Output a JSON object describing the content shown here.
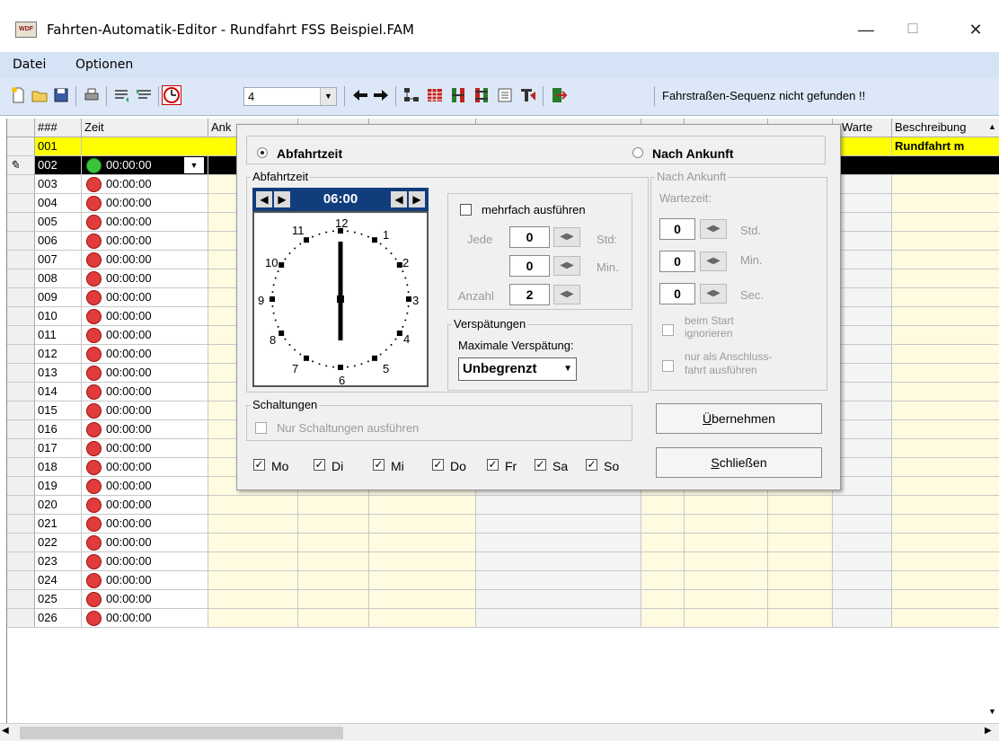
{
  "window": {
    "title": "Fahrten-Automatik-Editor - Rundfahrt FSS Beispiel.FAM",
    "app_icon_text": "WDF",
    "minimize": "—",
    "maximize": "☐",
    "close": "✕"
  },
  "menu": [
    {
      "label": "Datei"
    },
    {
      "label": "Optionen"
    }
  ],
  "toolbar": {
    "combo_value": "4",
    "status": "Fahrstraßen-Sequenz nicht gefunden !!"
  },
  "grid": {
    "columns": {
      "num": "###",
      "zeit": "Zeit",
      "ank": "Ank",
      "warte": "Warte",
      "beschreibung": "Beschreibung"
    },
    "first_row": {
      "num": "001",
      "beschreibung": "Rundfahrt m"
    },
    "selected_row": {
      "indicator": "✎",
      "num": "002",
      "zeit": "00:00:00"
    },
    "rows": [
      {
        "num": "003",
        "zeit": "00:00:00"
      },
      {
        "num": "004",
        "zeit": "00:00:00"
      },
      {
        "num": "005",
        "zeit": "00:00:00"
      },
      {
        "num": "006",
        "zeit": "00:00:00"
      },
      {
        "num": "007",
        "zeit": "00:00:00"
      },
      {
        "num": "008",
        "zeit": "00:00:00"
      },
      {
        "num": "009",
        "zeit": "00:00:00"
      },
      {
        "num": "010",
        "zeit": "00:00:00"
      },
      {
        "num": "011",
        "zeit": "00:00:00"
      },
      {
        "num": "012",
        "zeit": "00:00:00"
      },
      {
        "num": "013",
        "zeit": "00:00:00"
      },
      {
        "num": "014",
        "zeit": "00:00:00"
      },
      {
        "num": "015",
        "zeit": "00:00:00"
      },
      {
        "num": "016",
        "zeit": "00:00:00"
      },
      {
        "num": "017",
        "zeit": "00:00:00"
      },
      {
        "num": "018",
        "zeit": "00:00:00"
      },
      {
        "num": "019",
        "zeit": "00:00:00"
      },
      {
        "num": "020",
        "zeit": "00:00:00"
      },
      {
        "num": "021",
        "zeit": "00:00:00"
      },
      {
        "num": "022",
        "zeit": "00:00:00"
      },
      {
        "num": "023",
        "zeit": "00:00:00"
      },
      {
        "num": "024",
        "zeit": "00:00:00"
      },
      {
        "num": "025",
        "zeit": "00:00:00"
      },
      {
        "num": "026",
        "zeit": "00:00:00"
      }
    ]
  },
  "dialog": {
    "radio_abfahrt": "Abfahrtzeit",
    "radio_ankunft": "Nach Ankunft",
    "group_abfahrt": "Abfahrtzeit",
    "clock_time": "06:00",
    "clock_numbers": [
      "12",
      "1",
      "2",
      "3",
      "4",
      "5",
      "6",
      "7",
      "8",
      "9",
      "10",
      "11"
    ],
    "mehrfach_label": "mehrfach ausführen",
    "jede_label": "Jede",
    "jede_std_value": "0",
    "std_label": "Std:",
    "jede_min_value": "0",
    "min_label": "Min.",
    "anzahl_label": "Anzahl",
    "anzahl_value": "2",
    "group_verspaetung": "Verspätungen",
    "max_verspaetung_label": "Maximale Verspätung:",
    "verspaetung_value": "Unbegrenzt",
    "group_ankunft": "Nach Ankunft",
    "wartezeit_label": "Wartezeit:",
    "wait_std_value": "0",
    "wait_std_label": "Std.",
    "wait_min_value": "0",
    "wait_min_label": "Min.",
    "wait_sec_value": "0",
    "wait_sec_label": "Sec.",
    "beim_start_line1": "beim Start",
    "beim_start_line2": "ignorieren",
    "anschluss_line1": "nur als Anschluss-",
    "anschluss_line2": "fahrt ausführen",
    "group_schaltungen": "Schaltungen",
    "nur_schaltungen": "Nur Schaltungen ausführen",
    "weekdays": [
      "Mo",
      "Di",
      "Mi",
      "Do",
      "Fr",
      "Sa",
      "So"
    ],
    "btn_uebernehmen_underlined": "Ü",
    "btn_uebernehmen_rest": "bernehmen",
    "btn_schliessen_underlined": "S",
    "btn_schliessen_rest": "chließen"
  }
}
